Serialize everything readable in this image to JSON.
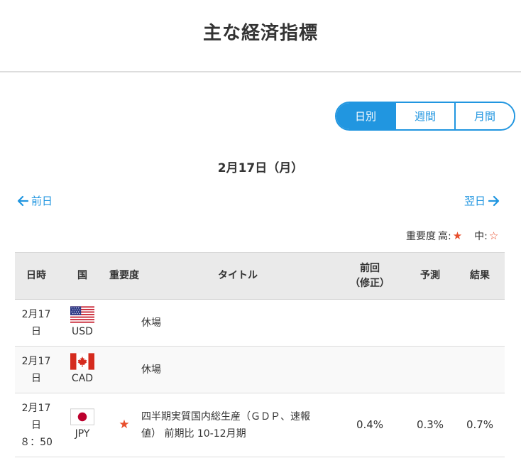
{
  "header": {
    "title": "主な経済指標"
  },
  "period_tabs": [
    {
      "label": "日別",
      "active": true
    },
    {
      "label": "週間",
      "active": false
    },
    {
      "label": "月間",
      "active": false
    }
  ],
  "date_title": "2月17日（月）",
  "nav": {
    "prev_label": "前日",
    "next_label": "翌日"
  },
  "legend": {
    "label": "重要度",
    "high_label": "高:",
    "high_symbol": "★",
    "mid_label": "中:",
    "mid_symbol": "☆"
  },
  "table": {
    "headers": {
      "time": "日時",
      "country": "国",
      "importance": "重要度",
      "title": "タイトル",
      "previous_line1": "前回",
      "previous_line2": "（修正）",
      "forecast": "予測",
      "result": "結果"
    },
    "rows": [
      {
        "date_line1": "2月17",
        "date_line2": "日",
        "time": "",
        "currency": "USD",
        "flag_icon": "us-flag-icon",
        "importance": "",
        "title_line1": "休場",
        "title_line2": "",
        "previous": "",
        "forecast": "",
        "result": ""
      },
      {
        "date_line1": "2月17",
        "date_line2": "日",
        "time": "",
        "currency": "CAD",
        "flag_icon": "canada-flag-icon",
        "importance": "",
        "title_line1": "休場",
        "title_line2": "",
        "previous": "",
        "forecast": "",
        "result": ""
      },
      {
        "date_line1": "2月17",
        "date_line2": "日",
        "time": "８：50",
        "currency": "JPY",
        "flag_icon": "japan-flag-icon",
        "importance": "★",
        "title_line1": "四半期実質国内総生産（ＧＤＰ、速報",
        "title_line2": "値） 前期比 10-12月期",
        "previous": "0.4%",
        "forecast": "0.3%",
        "result": "0.7%"
      }
    ]
  },
  "colors": {
    "accent": "#2196e0",
    "star": "#e84e2c",
    "header_bg": "#eaeaea"
  }
}
